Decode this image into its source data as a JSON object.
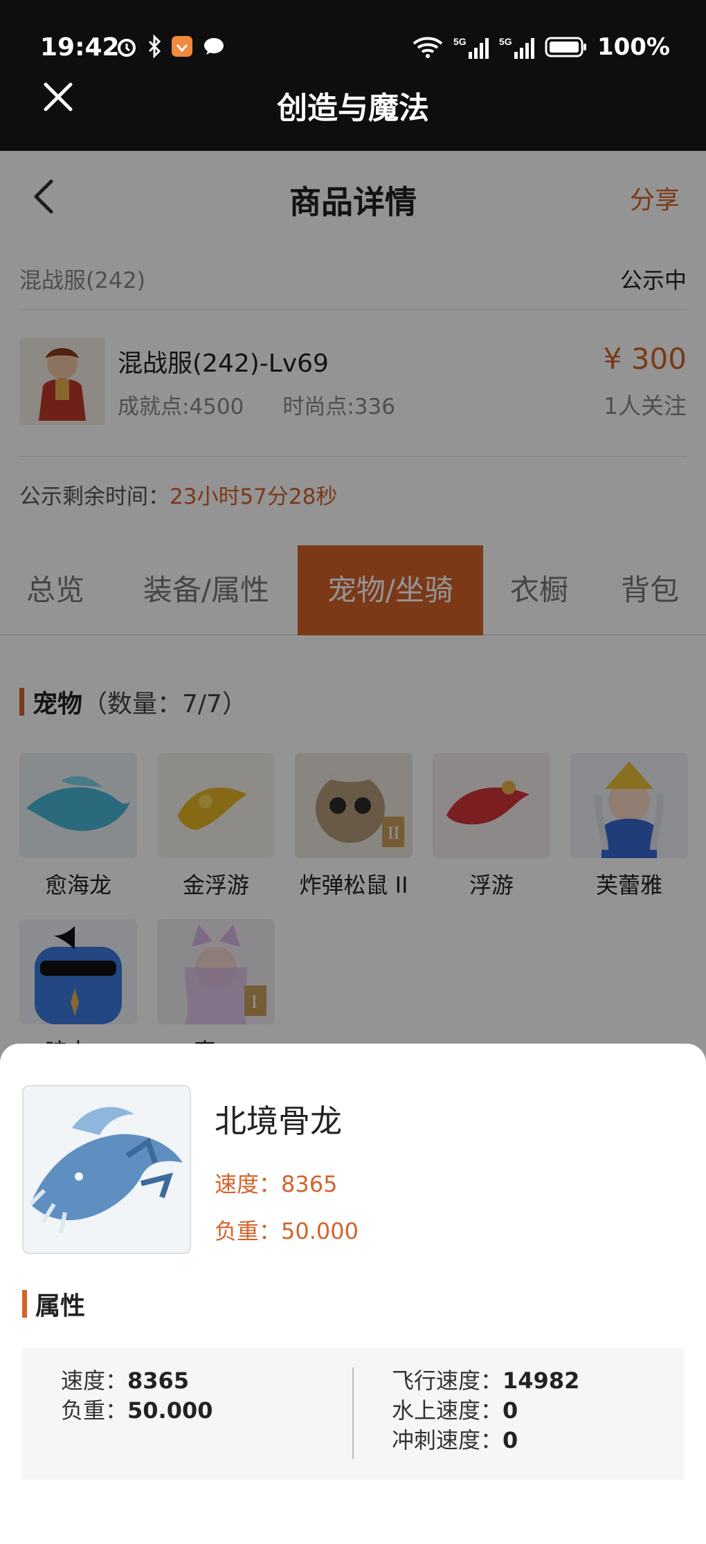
{
  "status_bar": {
    "time": "19:42",
    "battery": "100%"
  },
  "app_bar": {
    "title": "创造与魔法"
  },
  "nav": {
    "title": "商品详情",
    "share": "分享"
  },
  "listing": {
    "server": "混战服(242)",
    "status": "公示中",
    "name": "混战服(242)-Lv69",
    "achievement": "成就点:4500",
    "fashion": "时尚点:336",
    "price": "¥ 300",
    "followers": "1人关注",
    "timer_label": "公示剩余时间：",
    "timer_value": "23小时57分28秒"
  },
  "tabs": [
    {
      "label": "总览"
    },
    {
      "label": "装备/属性"
    },
    {
      "label": "宠物/坐骑"
    },
    {
      "label": "衣橱"
    },
    {
      "label": "背包"
    }
  ],
  "pets_section": {
    "title": "宠物",
    "count": "（数量：7/7）"
  },
  "pets": [
    {
      "name": "愈海龙"
    },
    {
      "name": "金浮游"
    },
    {
      "name": "炸弹松鼠 II"
    },
    {
      "name": "浮游"
    },
    {
      "name": "芙蕾雅"
    },
    {
      "name": "暗古…"
    },
    {
      "name": "索…"
    }
  ],
  "detail": {
    "name": "北境骨龙",
    "speed": "速度：8365",
    "load": "负重：50.000",
    "attr_title": "属性",
    "attrs_left": [
      {
        "label": "速度：",
        "value": "8365"
      },
      {
        "label": "负重：",
        "value": "50.000"
      }
    ],
    "attrs_right": [
      {
        "label": "飞行速度：",
        "value": "14982"
      },
      {
        "label": "水上速度：",
        "value": "0"
      },
      {
        "label": "冲刺速度：",
        "value": "0"
      }
    ]
  },
  "colors": {
    "accent": "#d4622a",
    "bar": "#0e0e0e"
  }
}
